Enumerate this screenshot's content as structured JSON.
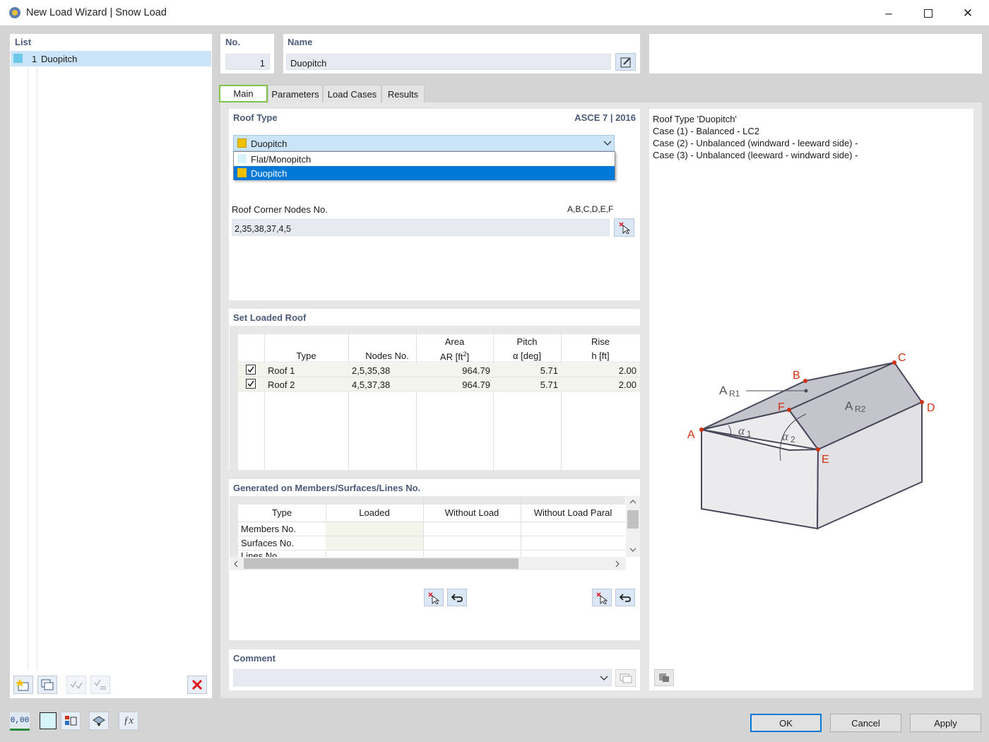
{
  "window": {
    "title": "New Load Wizard | Snow Load"
  },
  "list": {
    "header": "List",
    "items": [
      {
        "number": "1",
        "label": "Duopitch",
        "color": "#6cc8e8"
      }
    ]
  },
  "number": {
    "label": "No.",
    "value": "1"
  },
  "name": {
    "label": "Name",
    "value": "Duopitch"
  },
  "tabs": [
    "Main",
    "Parameters",
    "Load Cases",
    "Results"
  ],
  "roof_type": {
    "header": "Roof Type",
    "standard": "ASCE 7 | 2016",
    "selected": "Duopitch",
    "options": [
      {
        "label": "Flat/Monopitch",
        "color": "#d8f4fa"
      },
      {
        "label": "Duopitch",
        "color": "#f0c000"
      }
    ],
    "corner_label": "Roof Corner Nodes No.",
    "corner_hint": "A,B,C,D,E,F",
    "corner_value": "2,35,38,37,4,5"
  },
  "loaded_roof": {
    "header": "Set Loaded Roof",
    "columns": [
      {
        "top": "",
        "bottom": "Type"
      },
      {
        "top": "",
        "bottom": "Nodes No."
      },
      {
        "top": "Area",
        "bottom": "AR [ft2]"
      },
      {
        "top": "Pitch",
        "bottom": "α [deg]"
      },
      {
        "top": "Rise",
        "bottom": "h [ft]"
      }
    ],
    "rows": [
      {
        "checked": true,
        "type": "Roof 1",
        "nodes": "2,5,35,38",
        "area": "964.79",
        "pitch": "5.71",
        "rise": "2.00"
      },
      {
        "checked": true,
        "type": "Roof 2",
        "nodes": "4,5,37,38",
        "area": "964.79",
        "pitch": "5.71",
        "rise": "2.00"
      }
    ]
  },
  "generated": {
    "header": "Generated on Members/Surfaces/Lines No.",
    "columns": [
      "Type",
      "Loaded",
      "Without Load",
      "Without Load Paral"
    ],
    "rows": [
      "Members No.",
      "Surfaces No.",
      "Lines No."
    ]
  },
  "comment": {
    "header": "Comment",
    "value": ""
  },
  "info": {
    "lines": [
      "Roof Type 'Duopitch'",
      "Case (1) - Balanced - LC2",
      "Case (2) - Unbalanced (windward - leeward side) -",
      "Case (3) - Unbalanced (leeward - windward side) -"
    ]
  },
  "diagram": {
    "labels": {
      "A": "A",
      "B": "B",
      "C": "C",
      "D": "D",
      "E": "E",
      "F": "F"
    },
    "ar1": "A",
    "ar1_sub": "R1",
    "ar2": "A",
    "ar2_sub": "R2",
    "alpha1": "α",
    "alpha1_sub": "1",
    "alpha2": "α",
    "alpha2_sub": "2",
    "point_color": "#d03010",
    "roof_color": "#c4c4cc",
    "wall_color": "#ebebee"
  },
  "buttons": {
    "ok": "OK",
    "cancel": "Cancel",
    "apply": "Apply"
  },
  "status": {
    "units_icon": "0,00"
  }
}
